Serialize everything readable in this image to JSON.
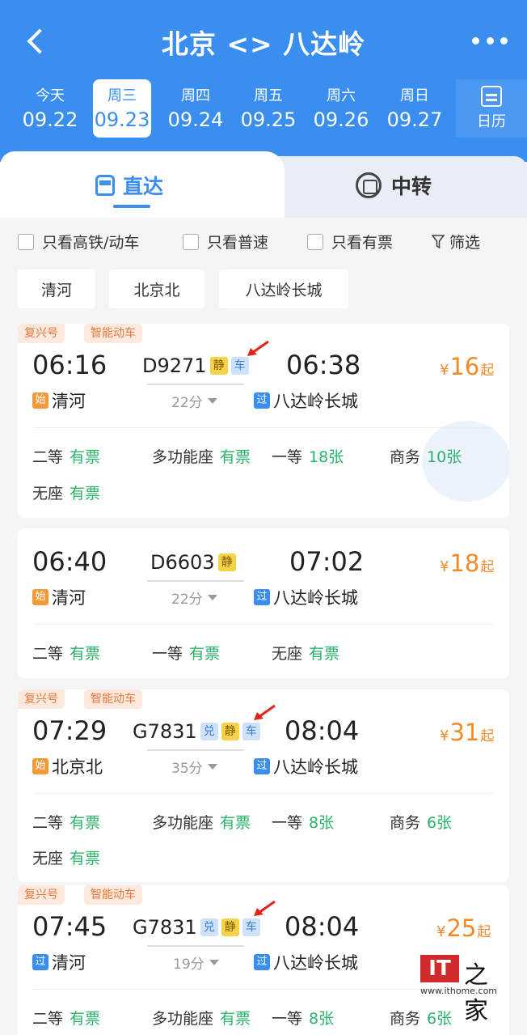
{
  "header": {
    "title": "北京 <> 八达岭",
    "dates": [
      {
        "weekday": "今天",
        "date": "09.22"
      },
      {
        "weekday": "周三",
        "date": "09.23"
      },
      {
        "weekday": "周四",
        "date": "09.24"
      },
      {
        "weekday": "周五",
        "date": "09.25"
      },
      {
        "weekday": "周六",
        "date": "09.26"
      },
      {
        "weekday": "周日",
        "date": "09.27"
      }
    ],
    "active_date_index": 1,
    "calendar_label": "日历"
  },
  "tabs": {
    "direct": "直达",
    "transfer": "中转"
  },
  "filters": {
    "high_speed": "只看高铁/动车",
    "normal": "只看普速",
    "available": "只看有票",
    "screen": "筛选"
  },
  "stations": [
    "清河",
    "北京北",
    "八达岭长城"
  ],
  "trains": [
    {
      "tags": [
        "复兴号",
        "智能动车"
      ],
      "depart": "06:16",
      "arrive": "06:38",
      "number": "D9271",
      "badges": [
        "静",
        "车"
      ],
      "duration": "22分",
      "from_mark": "始",
      "from": "清河",
      "to_mark": "过",
      "to": "八达岭长城",
      "currency": "¥",
      "price": "16",
      "price_suffix": "起",
      "seats": [
        {
          "name": "二等",
          "status": "有票"
        },
        {
          "name": "多功能座",
          "status": "有票"
        },
        {
          "name": "一等",
          "status": "18张"
        },
        {
          "name": "商务",
          "status": "10张"
        },
        {
          "name": "无座",
          "status": "有票"
        }
      ]
    },
    {
      "tags": [],
      "depart": "06:40",
      "arrive": "07:02",
      "number": "D6603",
      "badges": [
        "静"
      ],
      "duration": "22分",
      "from_mark": "始",
      "from": "清河",
      "to_mark": "过",
      "to": "八达岭长城",
      "currency": "¥",
      "price": "18",
      "price_suffix": "起",
      "seats": [
        {
          "name": "二等",
          "status": "有票"
        },
        {
          "name": "一等",
          "status": "有票"
        },
        {
          "name": "无座",
          "status": "有票"
        }
      ]
    },
    {
      "tags": [
        "复兴号",
        "智能动车"
      ],
      "depart": "07:29",
      "arrive": "08:04",
      "number": "G7831",
      "badges": [
        "兑",
        "静",
        "车"
      ],
      "duration": "35分",
      "from_mark": "始",
      "from": "北京北",
      "to_mark": "过",
      "to": "八达岭长城",
      "currency": "¥",
      "price": "31",
      "price_suffix": "起",
      "seats": [
        {
          "name": "二等",
          "status": "有票"
        },
        {
          "name": "多功能座",
          "status": "有票"
        },
        {
          "name": "一等",
          "status": "8张"
        },
        {
          "name": "商务",
          "status": "6张"
        },
        {
          "name": "无座",
          "status": "有票"
        }
      ]
    },
    {
      "tags": [
        "复兴号",
        "智能动车"
      ],
      "depart": "07:45",
      "arrive": "08:04",
      "number": "G7831",
      "badges": [
        "兑",
        "静",
        "车"
      ],
      "duration": "19分",
      "from_mark": "过",
      "from": "清河",
      "to_mark": "过",
      "to": "八达岭长城",
      "currency": "¥",
      "price": "25",
      "price_suffix": "起",
      "seats": [
        {
          "name": "二等",
          "status": "有票"
        },
        {
          "name": "多功能座",
          "status": "有票"
        },
        {
          "name": "一等",
          "status": "8张"
        },
        {
          "name": "商务",
          "status": "6张"
        }
      ]
    }
  ],
  "watermark": {
    "logo": "IT",
    "char": "之家",
    "url": "www.ithome.com"
  },
  "colors": {
    "brand": "#3a8ef0",
    "price": "#f28a2a",
    "available": "#2bb36a",
    "arrow": "#e0241b"
  }
}
